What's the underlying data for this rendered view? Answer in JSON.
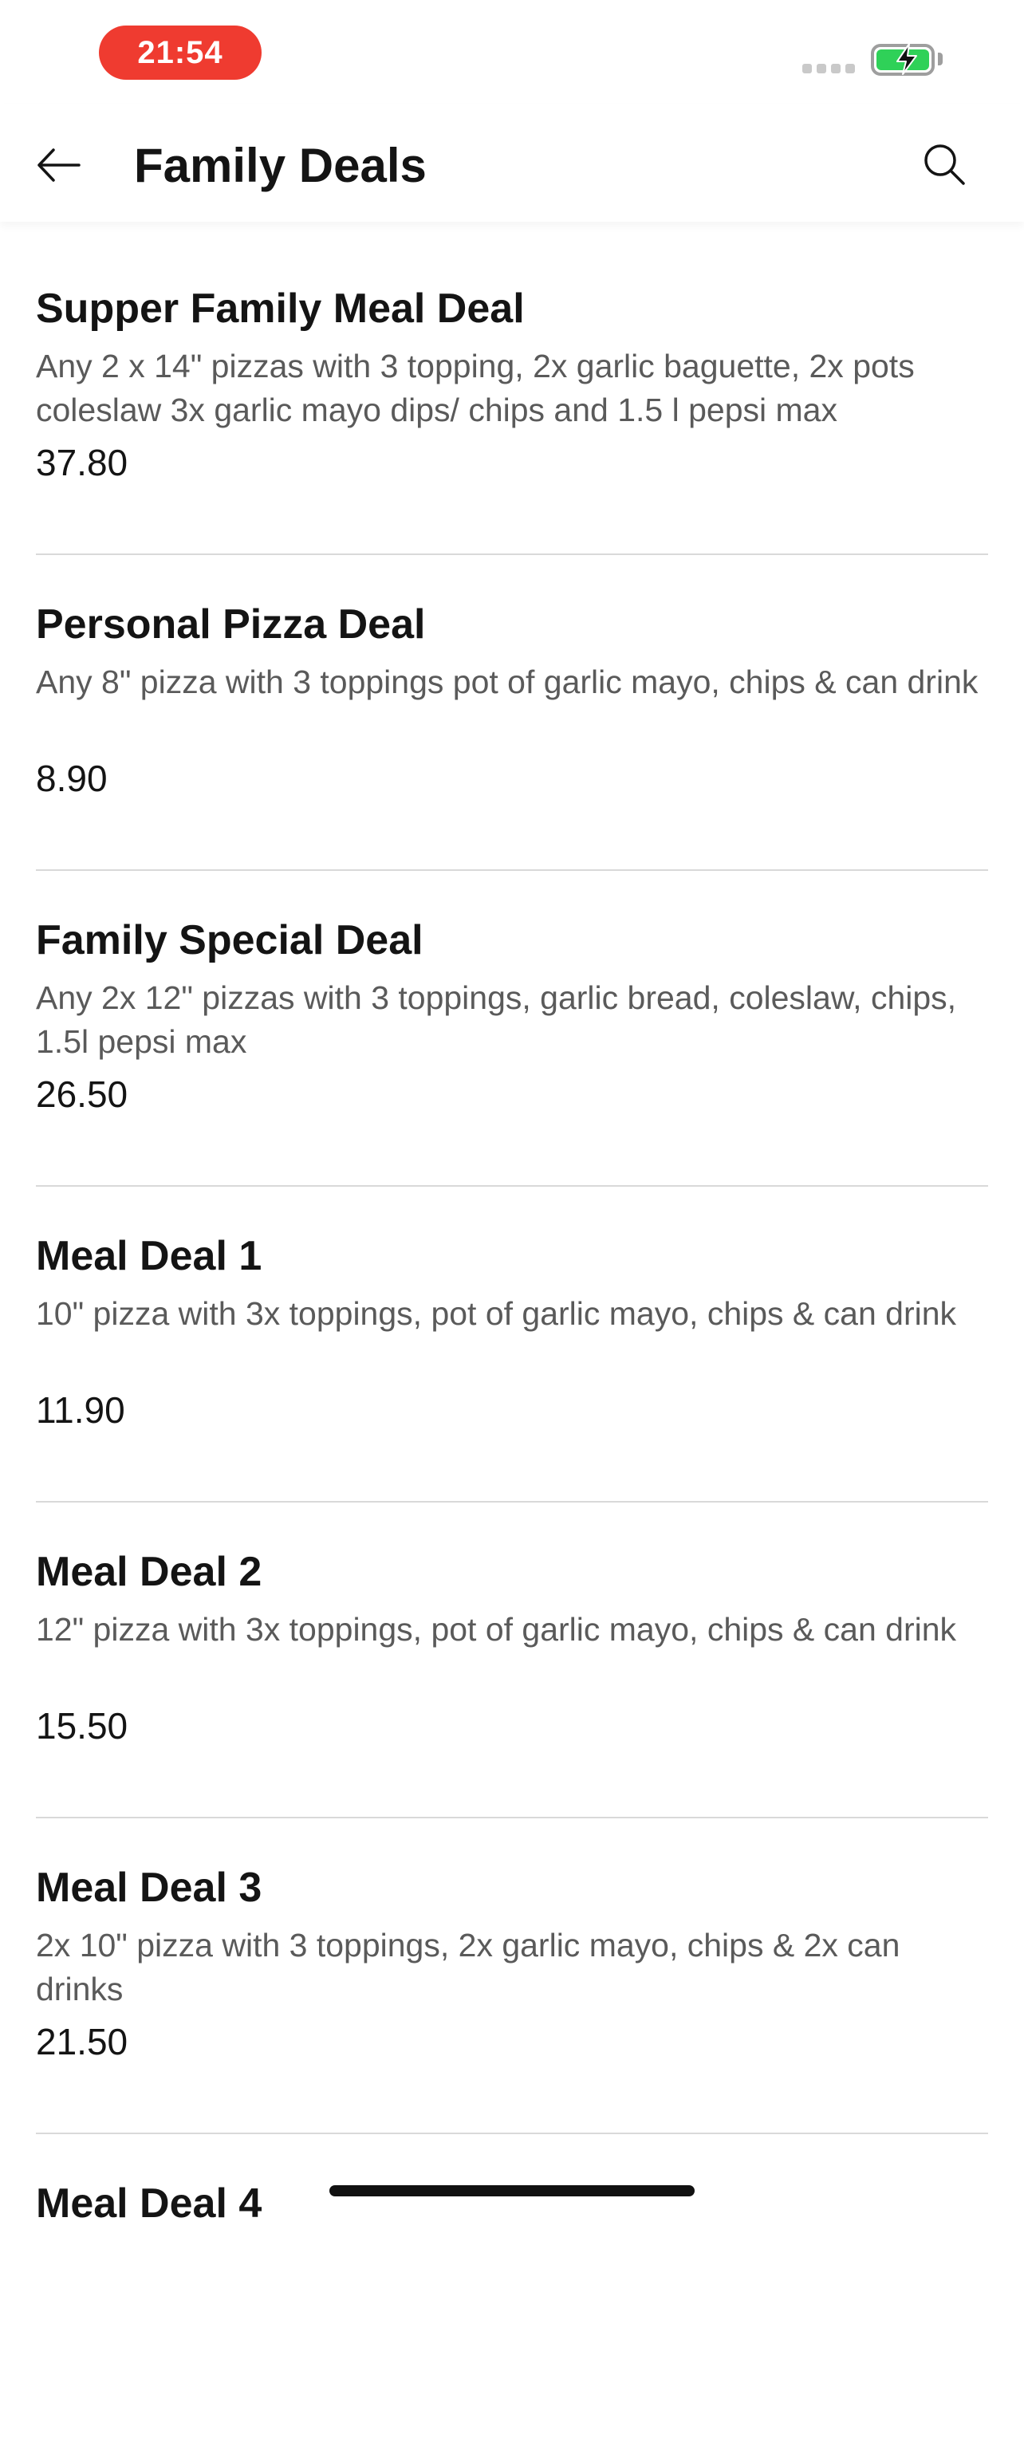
{
  "status_bar": {
    "time": "21:54",
    "signal_icon": "signal-dots-icon",
    "battery_icon": "battery-charging-icon",
    "battery_color": "#2fd158",
    "time_pill_color": "#ef3b30"
  },
  "header": {
    "title": "Family Deals",
    "back_icon": "arrow-left-icon",
    "search_icon": "search-icon"
  },
  "deals": [
    {
      "name": "Supper Family Meal Deal",
      "description": "Any 2 x 14\" pizzas with 3 topping,  2x garlic baguette, 2x pots coleslaw 3x garlic mayo dips/ chips and 1.5 l pepsi max",
      "price": "37.80"
    },
    {
      "name": "Personal Pizza Deal",
      "description": "Any 8\" pizza with 3 toppings pot of garlic mayo, chips & can drink",
      "price": "8.90"
    },
    {
      "name": "Family Special Deal",
      "description": "Any 2x 12\" pizzas with 3 toppings, garlic bread, coleslaw, chips, 1.5l pepsi max",
      "price": "26.50"
    },
    {
      "name": "Meal Deal 1",
      "description": "10\" pizza with 3x toppings, pot of garlic mayo, chips & can drink",
      "price": "11.90"
    },
    {
      "name": "Meal Deal 2",
      "description": "12\" pizza with 3x toppings, pot of garlic mayo, chips & can drink",
      "price": "15.50"
    },
    {
      "name": "Meal Deal 3",
      "description": "2x 10\" pizza with 3 toppings, 2x garlic mayo, chips & 2x can drinks",
      "price": "21.50"
    },
    {
      "name": "Meal Deal 4"
    }
  ]
}
